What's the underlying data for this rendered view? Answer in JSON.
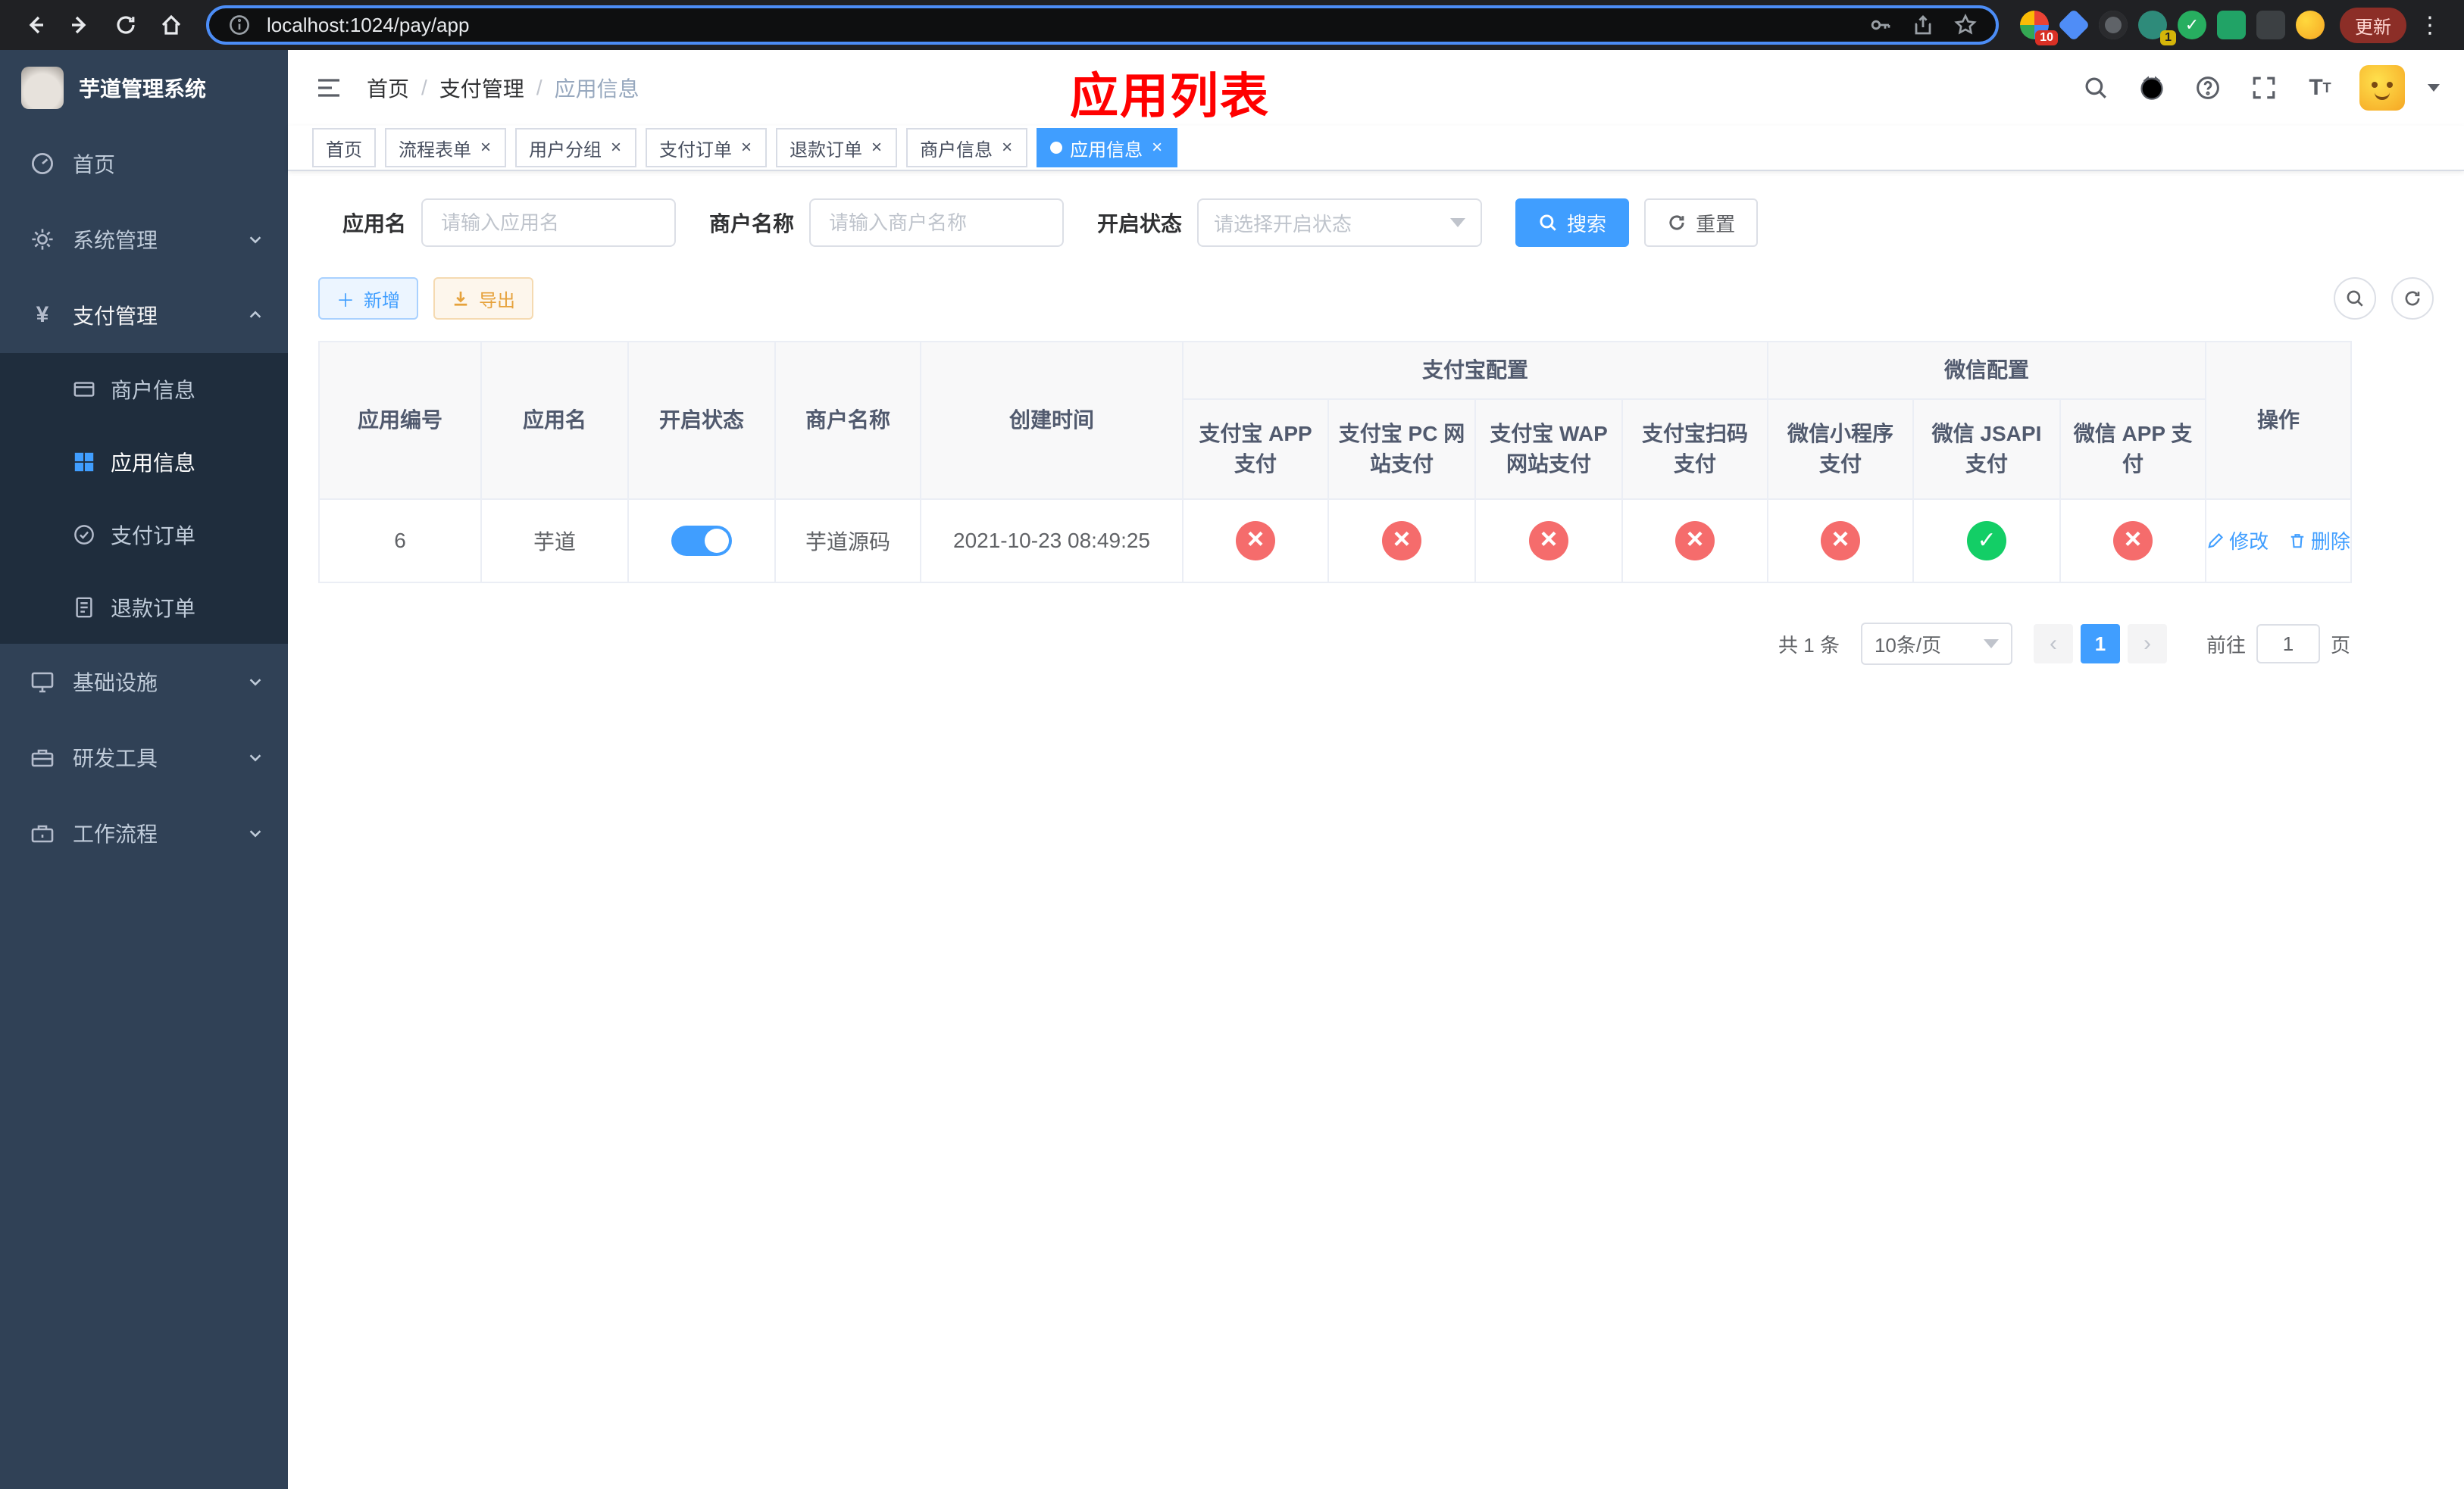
{
  "colors": {
    "accent": "#409eff",
    "danger": "#f56c6c",
    "success": "#13ce66",
    "warning": "#e6a23c",
    "sidebar_bg": "#304156",
    "submenu_bg": "#1f2d3d",
    "annotation_red": "#ff0000"
  },
  "browser": {
    "url": "localhost:1024/pay/app",
    "update_button": "更新",
    "extension_badge_1": "10",
    "extension_badge_2": "1",
    "icons": [
      "back-icon",
      "forward-icon",
      "reload-icon",
      "home-icon",
      "site-info-icon",
      "key-icon",
      "share-icon",
      "bookmark-star-icon",
      "menu-dots-icon"
    ]
  },
  "sidebar": {
    "title": "芋道管理系统",
    "items": [
      {
        "label": "首页",
        "icon": "dashboard-icon"
      },
      {
        "label": "系统管理",
        "icon": "gear-icon",
        "chevron": "down"
      },
      {
        "label": "支付管理",
        "icon": "yen-icon",
        "chevron": "up",
        "active": true
      },
      {
        "label": "基础设施",
        "icon": "infrastructure-icon",
        "chevron": "down"
      },
      {
        "label": "研发工具",
        "icon": "devtools-icon",
        "chevron": "down"
      },
      {
        "label": "工作流程",
        "icon": "workflow-icon",
        "chevron": "down"
      }
    ],
    "submenu": [
      {
        "label": "商户信息",
        "icon": "merchant-card-icon"
      },
      {
        "label": "应用信息",
        "icon": "app-grid-icon",
        "active": true
      },
      {
        "label": "支付订单",
        "icon": "pay-order-icon"
      },
      {
        "label": "退款订单",
        "icon": "refund-order-icon"
      }
    ]
  },
  "header": {
    "breadcrumb": [
      "首页",
      "支付管理",
      "应用信息"
    ],
    "annotation": "应用列表",
    "icons": [
      "search-icon",
      "github-icon",
      "help-icon",
      "fullscreen-icon",
      "font-size-icon",
      "avatar",
      "caret-down-icon"
    ]
  },
  "tabs": [
    {
      "label": "首页",
      "closable": false,
      "active": false
    },
    {
      "label": "流程表单",
      "closable": true,
      "active": false
    },
    {
      "label": "用户分组",
      "closable": true,
      "active": false
    },
    {
      "label": "支付订单",
      "closable": true,
      "active": false
    },
    {
      "label": "退款订单",
      "closable": true,
      "active": false
    },
    {
      "label": "商户信息",
      "closable": true,
      "active": false
    },
    {
      "label": "应用信息",
      "closable": true,
      "active": true
    }
  ],
  "filters": {
    "app_name_label": "应用名",
    "app_name_placeholder": "请输入应用名",
    "merchant_label": "商户名称",
    "merchant_placeholder": "请输入商户名称",
    "status_label": "开启状态",
    "status_placeholder": "请选择开启状态",
    "search_label": "搜索",
    "reset_label": "重置"
  },
  "toolbar": {
    "add_label": "新增",
    "export_label": "导出"
  },
  "table": {
    "alipay_group": "支付宝配置",
    "wechat_group": "微信配置",
    "columns": {
      "app_id": "应用编号",
      "app_name": "应用名",
      "status": "开启状态",
      "merchant": "商户名称",
      "created": "创建时间",
      "actions": "操作",
      "alipay": [
        "支付宝 APP 支付",
        "支付宝 PC 网站支付",
        "支付宝 WAP 网站支付",
        "支付宝扫码支付"
      ],
      "wechat": [
        "微信小程序支付",
        "微信 JSAPI 支付",
        "微信 APP 支付"
      ]
    },
    "rows": [
      {
        "app_id": "6",
        "app_name": "芋道",
        "enabled": true,
        "merchant": "芋道源码",
        "created": "2021-10-23 08:49:25",
        "alipay_app": false,
        "alipay_pc": false,
        "alipay_wap": false,
        "alipay_qr": false,
        "wechat_mini": false,
        "wechat_jsapi": true,
        "wechat_app": false,
        "edit": "修改",
        "delete": "删除"
      }
    ]
  },
  "pagination": {
    "total": "共 1 条",
    "page_size": "10条/页",
    "page": "1",
    "goto_prefix": "前往",
    "goto_value": "1",
    "goto_suffix": "页"
  }
}
